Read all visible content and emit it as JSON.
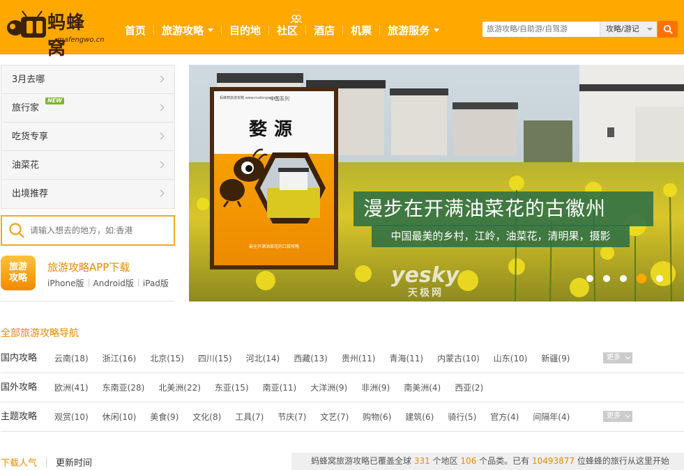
{
  "brand": {
    "name": "蚂蜂窝",
    "domain": "mafengwo.cn",
    "colors": {
      "header": "#ffa800",
      "accent": "#ea8a00",
      "search_button": "#ff7200"
    }
  },
  "nav": {
    "items": [
      {
        "label": "首页",
        "dropdown": false
      },
      {
        "label": "旅游攻略",
        "dropdown": true
      },
      {
        "label": "目的地",
        "dropdown": false
      },
      {
        "label": "社区",
        "dropdown": false
      },
      {
        "label": "酒店",
        "dropdown": false
      },
      {
        "label": "机票",
        "dropdown": false
      },
      {
        "label": "旅游服务",
        "dropdown": true
      }
    ]
  },
  "search": {
    "placeholder": "旅游攻略/自助游/自驾游",
    "type_selected": "攻略/游记"
  },
  "sidebar": {
    "items": [
      {
        "label": "3月去哪"
      },
      {
        "label": "旅行家",
        "badge": "NEW"
      },
      {
        "label": "吃货专享"
      },
      {
        "label": "油菜花"
      },
      {
        "label": "出境推荐"
      }
    ],
    "dest_search_placeholder": "请输入想去的地方，如:香港",
    "app": {
      "icon_text_1": "旅游",
      "icon_text_2": "攻略",
      "title": "旅游攻略APP下载",
      "links": [
        "iPhone版",
        "Android版",
        "iPad版"
      ]
    }
  },
  "banner": {
    "headline": "漫步在开满油菜花的古徽州",
    "subline": "中国最美的乡村，江岭，油菜花，清明果，摄影",
    "book": {
      "publisher": "蚂蜂窝旅游攻略 www.mafengwo.cn",
      "series": "中国系列",
      "title": "婺源",
      "tagline": "最全开满油菜花的口袋攻略"
    },
    "watermark": "yesky",
    "watermark_cn": "天极网",
    "slides": 5,
    "active_slide": 4
  },
  "guide": {
    "title": "全部旅游攻略导航",
    "more_label": "更多",
    "rows": [
      {
        "label": "国内攻略",
        "items": [
          "云南(18)",
          "浙江(16)",
          "北京(15)",
          "四川(15)",
          "河北(14)",
          "西藏(13)",
          "贵州(11)",
          "青海(11)",
          "内蒙古(10)",
          "山东(10)",
          "新疆(9)"
        ],
        "more": true
      },
      {
        "label": "国外攻略",
        "items": [
          "欧洲(41)",
          "东南亚(28)",
          "北美洲(22)",
          "东亚(15)",
          "南亚(11)",
          "大洋洲(9)",
          "非洲(9)",
          "南美洲(4)",
          "西亚(2)"
        ],
        "more": false
      },
      {
        "label": "主题攻略",
        "items": [
          "观赏(10)",
          "休闲(10)",
          "美食(9)",
          "文化(8)",
          "工具(7)",
          "节庆(7)",
          "文艺(7)",
          "购物(6)",
          "建筑(6)",
          "骑行(5)",
          "官方(4)",
          "间隔年(4)"
        ],
        "more": true
      }
    ]
  },
  "footer": {
    "tabs": [
      "下载人气",
      "更新时间"
    ],
    "stats": {
      "prefix": "蚂蜂窝旅游攻略已覆盖全球",
      "regions": "331",
      "mid1": "个地区",
      "categories": "106",
      "mid2": "个品类。已有",
      "users": "10493877",
      "suffix": "位蜂蜂的旅行从这里开始"
    }
  }
}
